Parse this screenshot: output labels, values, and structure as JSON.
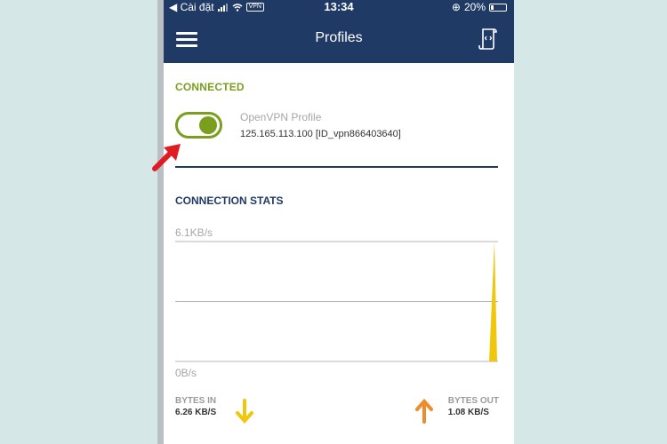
{
  "statusbar": {
    "carrier": "◀ Cài đặt",
    "vpn_badge": "VPN",
    "time": "13:34",
    "battery": "20%",
    "battery_level": 0.2
  },
  "navbar": {
    "title": "Profiles",
    "menu_icon": "hamburger-menu-icon",
    "import_icon": "document-import-icon"
  },
  "connection": {
    "status": "CONNECTED",
    "toggle_on": true,
    "profile_name": "OpenVPN Profile",
    "profile_address": "125.165.113.100 [ID_vpn866403640]"
  },
  "stats": {
    "heading": "CONNECTION STATS",
    "bytes_in_label": "BYTES IN",
    "bytes_in_value": "6.26 KB/S",
    "bytes_out_label": "BYTES OUT",
    "bytes_out_value": "1.08 KB/S"
  },
  "chart_data": {
    "type": "area",
    "y_tick_labels": [
      "6.1KB/s",
      "0B/s"
    ],
    "ylim": [
      0,
      6.1
    ],
    "grid": true,
    "series": [
      {
        "values": [
          0,
          0,
          0,
          0,
          0,
          0,
          0,
          0,
          0,
          0,
          0,
          0,
          0,
          0,
          0,
          0,
          0,
          0,
          0,
          6.1
        ]
      }
    ]
  },
  "colors": {
    "navy": "#203a66",
    "green": "#7a9e1e",
    "yellow": "#f1c70d",
    "orange": "#ee8b2c",
    "red_annotation": "#e11b22"
  }
}
